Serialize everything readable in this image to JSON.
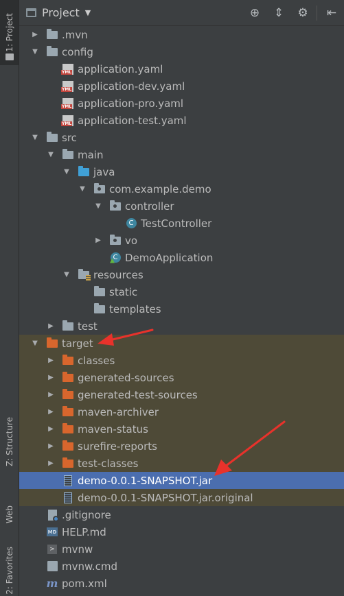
{
  "side_tabs": {
    "project": "1: Project",
    "structure": "Z: Structure",
    "web": "Web",
    "favorites": "2: Favorites"
  },
  "header": {
    "title": "Project",
    "icons": [
      "locate-icon",
      "collapse-all-icon",
      "gear-icon",
      "hide-icon"
    ]
  },
  "tree": [
    {
      "label": ".mvn",
      "icon": "folder",
      "depth": 1,
      "arrow": "collapsed"
    },
    {
      "label": "config",
      "icon": "folder",
      "depth": 1,
      "arrow": "expanded"
    },
    {
      "label": "application.yaml",
      "icon": "yml",
      "depth": 2,
      "arrow": "none"
    },
    {
      "label": "application-dev.yaml",
      "icon": "yml",
      "depth": 2,
      "arrow": "none"
    },
    {
      "label": "application-pro.yaml",
      "icon": "yml",
      "depth": 2,
      "arrow": "none"
    },
    {
      "label": "application-test.yaml",
      "icon": "yml",
      "depth": 2,
      "arrow": "none"
    },
    {
      "label": "src",
      "icon": "folder",
      "depth": 1,
      "arrow": "expanded"
    },
    {
      "label": "main",
      "icon": "folder",
      "depth": 2,
      "arrow": "expanded"
    },
    {
      "label": "java",
      "icon": "folder-blue",
      "depth": 3,
      "arrow": "expanded"
    },
    {
      "label": "com.example.demo",
      "icon": "package",
      "depth": 4,
      "arrow": "expanded"
    },
    {
      "label": "controller",
      "icon": "package",
      "depth": 5,
      "arrow": "expanded"
    },
    {
      "label": "TestController",
      "icon": "class",
      "depth": 6,
      "arrow": "none"
    },
    {
      "label": "vo",
      "icon": "package",
      "depth": 5,
      "arrow": "collapsed"
    },
    {
      "label": "DemoApplication",
      "icon": "app-class",
      "depth": 5,
      "arrow": "none"
    },
    {
      "label": "resources",
      "icon": "resources",
      "depth": 3,
      "arrow": "expanded"
    },
    {
      "label": "static",
      "icon": "folder",
      "depth": 4,
      "arrow": "none"
    },
    {
      "label": "templates",
      "icon": "folder",
      "depth": 4,
      "arrow": "none"
    },
    {
      "label": "test",
      "icon": "folder",
      "depth": 2,
      "arrow": "collapsed"
    },
    {
      "label": "target",
      "icon": "folder-orange",
      "depth": 1,
      "arrow": "expanded",
      "excluded": true
    },
    {
      "label": "classes",
      "icon": "folder-orange",
      "depth": 2,
      "arrow": "collapsed",
      "excluded": true
    },
    {
      "label": "generated-sources",
      "icon": "folder-orange",
      "depth": 2,
      "arrow": "collapsed",
      "excluded": true
    },
    {
      "label": "generated-test-sources",
      "icon": "folder-orange",
      "depth": 2,
      "arrow": "collapsed",
      "excluded": true
    },
    {
      "label": "maven-archiver",
      "icon": "folder-orange",
      "depth": 2,
      "arrow": "collapsed",
      "excluded": true
    },
    {
      "label": "maven-status",
      "icon": "folder-orange",
      "depth": 2,
      "arrow": "collapsed",
      "excluded": true
    },
    {
      "label": "surefire-reports",
      "icon": "folder-orange",
      "depth": 2,
      "arrow": "collapsed",
      "excluded": true
    },
    {
      "label": "test-classes",
      "icon": "folder-orange",
      "depth": 2,
      "arrow": "collapsed",
      "excluded": true
    },
    {
      "label": "demo-0.0.1-SNAPSHOT.jar",
      "icon": "jar",
      "depth": 2,
      "arrow": "none",
      "excluded": true,
      "selected": true
    },
    {
      "label": "demo-0.0.1-SNAPSHOT.jar.original",
      "icon": "jar",
      "depth": 2,
      "arrow": "none",
      "excluded": true
    },
    {
      "label": ".gitignore",
      "icon": "git",
      "depth": 1,
      "arrow": "none"
    },
    {
      "label": "HELP.md",
      "icon": "md",
      "depth": 1,
      "arrow": "none"
    },
    {
      "label": "mvnw",
      "icon": "terminal",
      "depth": 1,
      "arrow": "none"
    },
    {
      "label": "mvnw.cmd",
      "icon": "cmd",
      "depth": 1,
      "arrow": "none"
    },
    {
      "label": "pom.xml",
      "icon": "maven",
      "depth": 1,
      "arrow": "none"
    }
  ],
  "colors": {
    "background": "#3c3f41",
    "excluded_row": "#4e4a37",
    "selection": "#4b6eaf",
    "annotation_arrow": "#e8322b"
  }
}
